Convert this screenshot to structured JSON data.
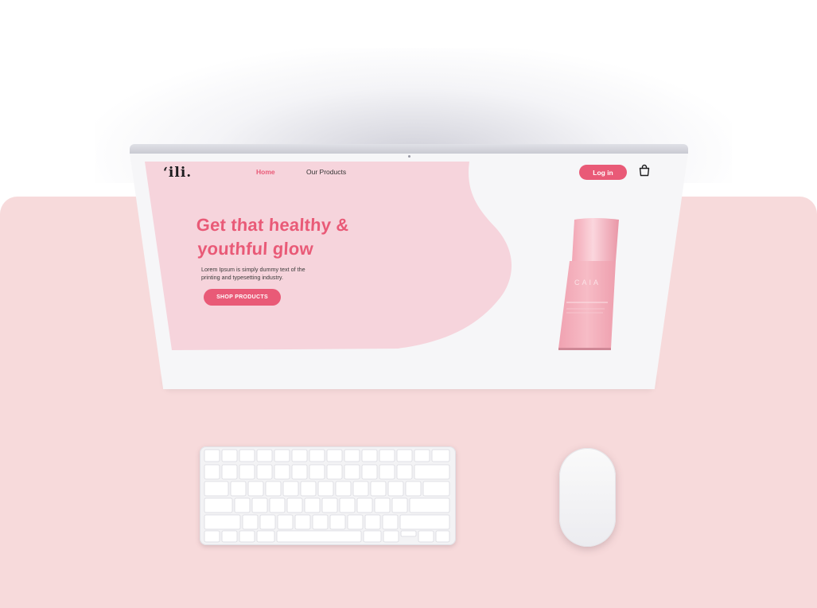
{
  "site": {
    "logo": "‘ili.",
    "nav": {
      "home": "Home",
      "products": "Our Products"
    },
    "login_label": "Log in",
    "cart_icon": "shopping-bag-icon"
  },
  "hero": {
    "headline_line1": "Get that healthy &",
    "headline_line2": "youthful glow",
    "subtext_line1": "Lorem Ipsum is simply dummy text of the",
    "subtext_line2": "printing and typesetting industry.",
    "cta_label": "SHOP PRODUCTS"
  },
  "product": {
    "brand": "CAIA"
  },
  "colors": {
    "accent": "#e95a77",
    "hero_bg": "#f6d4dc",
    "desk": "#f7dadb",
    "bottle": "#f3adb9"
  }
}
